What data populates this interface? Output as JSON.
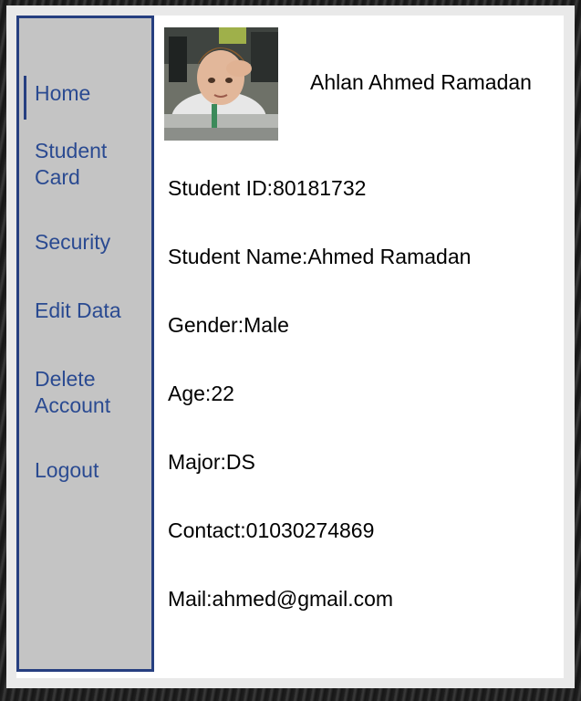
{
  "sidebar": {
    "items": [
      {
        "label": "Home",
        "active": true
      },
      {
        "label": "Student\nCard"
      },
      {
        "label": "Security"
      },
      {
        "label": "Edit Data"
      },
      {
        "label": "Delete\nAccount"
      },
      {
        "label": "Logout"
      }
    ]
  },
  "header": {
    "greeting": "Ahlan Ahmed Ramadan"
  },
  "profile": {
    "student_id": "Student ID:80181732",
    "student_name": "Student Name:Ahmed Ramadan",
    "gender": "Gender:Male",
    "age": "Age:22",
    "major": "Major:DS",
    "contact": "Contact:01030274869",
    "mail": "Mail:ahmed@gmail.com"
  },
  "colors": {
    "accent": "#263f80",
    "nav_text": "#2a4a91",
    "sidebar_bg": "#c4c4c4"
  }
}
